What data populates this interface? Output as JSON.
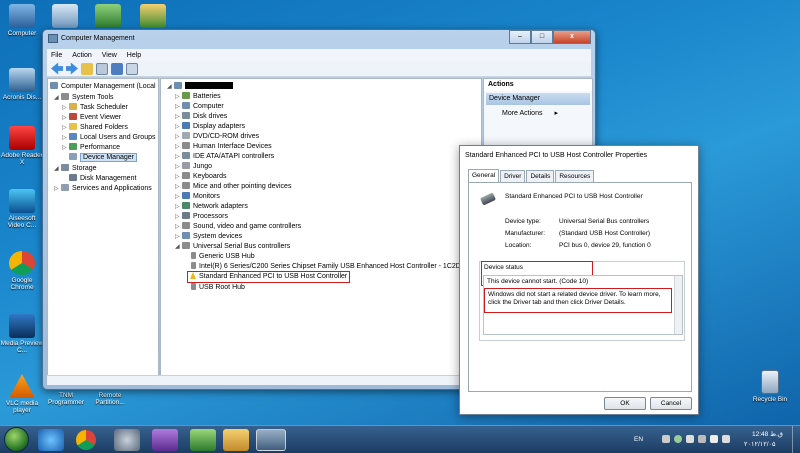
{
  "desktop": {
    "icons": [
      {
        "label": "Computer"
      },
      {
        "label": "Acronis Dis..."
      },
      {
        "label": "Adobe Reader X"
      },
      {
        "label": "Aiseesoft Video C..."
      },
      {
        "label": "Google Chrome"
      },
      {
        "label": "Media Preview C..."
      },
      {
        "label": "VLC media player"
      },
      {
        "label": "TNM Programmer"
      },
      {
        "label": "Remote Partition..."
      },
      {
        "label": "Recycle Bin"
      }
    ]
  },
  "window": {
    "title": "Computer Management",
    "menu": [
      "File",
      "Action",
      "View",
      "Help"
    ],
    "controls": {
      "minimize": "–",
      "maximize": "□",
      "close": "x"
    },
    "left_tree": [
      {
        "label": "Computer Management (Local"
      },
      {
        "label": "System Tools"
      },
      {
        "label": "Task Scheduler"
      },
      {
        "label": "Event Viewer"
      },
      {
        "label": "Shared Folders"
      },
      {
        "label": "Local Users and Groups"
      },
      {
        "label": "Performance"
      },
      {
        "label": "Device Manager"
      },
      {
        "label": "Storage"
      },
      {
        "label": "Disk Management"
      },
      {
        "label": "Services and Applications"
      }
    ],
    "device_tree": [
      {
        "label": "Batteries"
      },
      {
        "label": "Computer"
      },
      {
        "label": "Disk drives"
      },
      {
        "label": "Display adapters"
      },
      {
        "label": "DVD/CD-ROM drives"
      },
      {
        "label": "Human Interface Devices"
      },
      {
        "label": "IDE ATA/ATAPI controllers"
      },
      {
        "label": "Jungo"
      },
      {
        "label": "Keyboards"
      },
      {
        "label": "Mice and other pointing devices"
      },
      {
        "label": "Monitors"
      },
      {
        "label": "Network adapters"
      },
      {
        "label": "Processors"
      },
      {
        "label": "Sound, video and game controllers"
      },
      {
        "label": "System devices"
      },
      {
        "label": "Universal Serial Bus controllers"
      },
      {
        "label": "Generic USB Hub"
      },
      {
        "label": "Intel(R) 6 Series/C200 Series Chipset Family USB Enhanced Host Controller - 1C2D"
      },
      {
        "label": "Standard Enhanced PCI to USB Host Controller"
      },
      {
        "label": "USB Root Hub"
      }
    ],
    "actions": {
      "header": "Actions",
      "section": "Device Manager",
      "more": "More Actions"
    }
  },
  "dialog": {
    "title": "Standard Enhanced PCI to USB Host Controller Properties",
    "tabs": [
      "General",
      "Driver",
      "Details",
      "Resources"
    ],
    "device_name": "Standard Enhanced PCI to USB Host Controller",
    "fields": {
      "type_label": "Device type:",
      "type_value": "Universal Serial Bus controllers",
      "manufacturer_label": "Manufacturer:",
      "manufacturer_value": "(Standard USB Host Controller)",
      "location_label": "Location:",
      "location_value": "PCI bus 0, device 29, function 0"
    },
    "status_label": "Device status",
    "status_line1": "This device cannot start. (Code 10)",
    "status_line2": "Windows did not start a related device driver. To learn more, click the Driver tab and then click Driver Details.",
    "ok": "OK",
    "cancel": "Cancel"
  },
  "taskbar": {
    "lang": "EN",
    "time": "12:48 ق.ظ",
    "date": "۲۰۱۲/۱۲/۰۵"
  }
}
